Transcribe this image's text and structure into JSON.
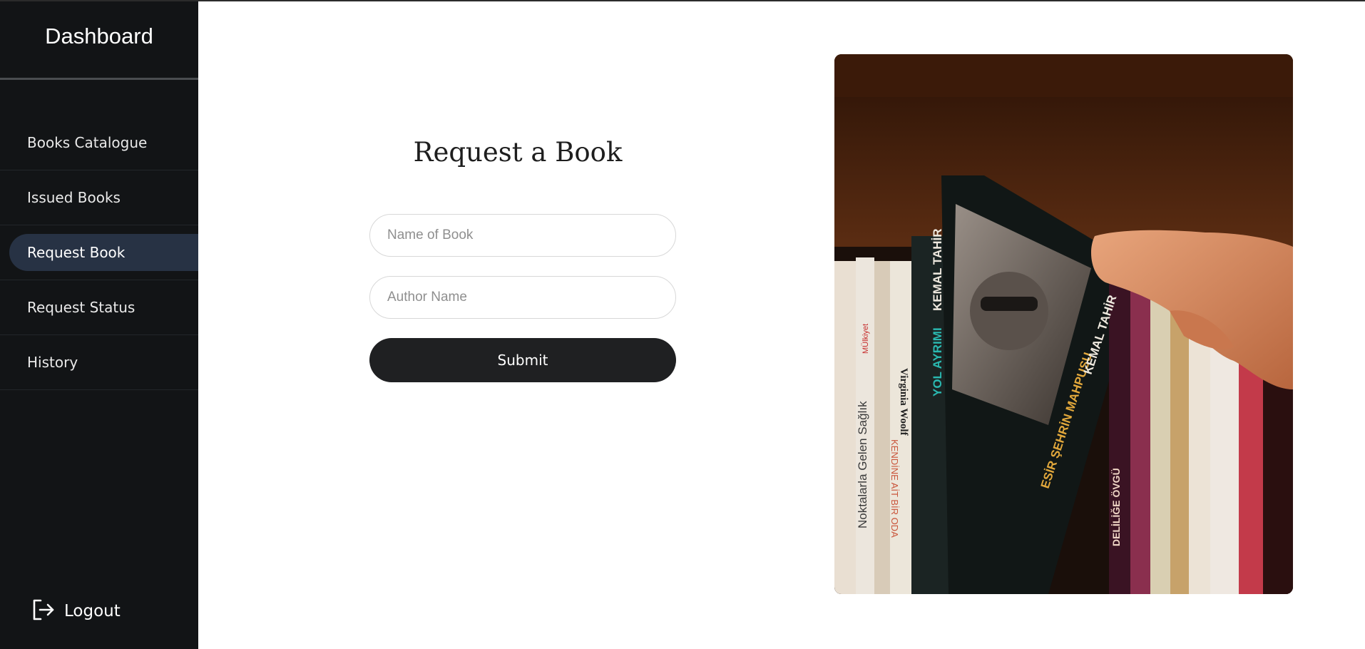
{
  "sidebar": {
    "title": "Dashboard",
    "items": [
      {
        "label": "Books Catalogue"
      },
      {
        "label": "Issued Books"
      },
      {
        "label": "Request Book"
      },
      {
        "label": "Request Status"
      },
      {
        "label": "History"
      }
    ],
    "active_index": 2,
    "logout_label": "Logout",
    "logout_icon": "logout-icon"
  },
  "form": {
    "title": "Request a Book",
    "book_placeholder": "Name of Book",
    "author_placeholder": "Author Name",
    "submit_label": "Submit"
  },
  "photo": {
    "spine_texts": [
      "Noktalarla Gelen Sağlık",
      "Virginia Woolf",
      "KENDİNE AİT BİR ODA",
      "YOL AYRIMI",
      "KEMAL TAHİR",
      "ESİR ŞEHRİN MAHPUSU",
      "KEMAL TAHİR",
      "DELİLİĞE ÖVGÜ",
      "MÜlkiyet"
    ]
  },
  "colors": {
    "sidebar_bg": "#121416",
    "active_bg": "#273244",
    "button_bg": "#1f2022"
  }
}
